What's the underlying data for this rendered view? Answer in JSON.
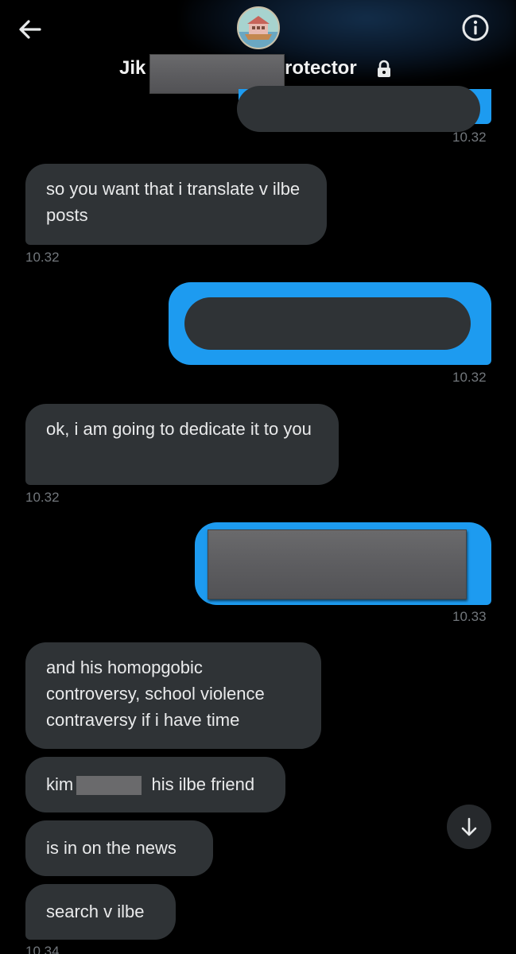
{
  "header": {
    "name_prefix": "Jik",
    "name_suffix": "rotector",
    "back_icon": "arrow-left-icon",
    "info_icon": "info-icon",
    "lock_icon": "lock-icon"
  },
  "messages": [
    {
      "side": "out",
      "text": "",
      "redacted": true,
      "time": "10.32"
    },
    {
      "side": "in",
      "text": "so you want that i translate v ilbe posts",
      "time": "10.32"
    },
    {
      "side": "out",
      "text": "",
      "redacted": true,
      "time": "10.32"
    },
    {
      "side": "in",
      "text": "ok, i am going to dedicate it to you",
      "time": "10.32"
    },
    {
      "side": "out",
      "text": "",
      "redacted": true,
      "time": "10.33"
    },
    {
      "side": "in",
      "text": "and his homopgobic controversy, school violence contraversy if i have time"
    },
    {
      "side": "in",
      "text_prefix": "kim",
      "text_suffix": "his ilbe friend",
      "redacted_partial": true
    },
    {
      "side": "in",
      "text": "is in on the news"
    },
    {
      "side": "in",
      "text": "search v ilbe",
      "time": "10.34"
    }
  ],
  "scroll_button": {
    "icon": "arrow-down-icon"
  },
  "colors": {
    "background": "#000000",
    "incoming_bubble": "#2f3336",
    "outgoing_bubble": "#1d9bf0",
    "timestamp": "#71767b"
  }
}
